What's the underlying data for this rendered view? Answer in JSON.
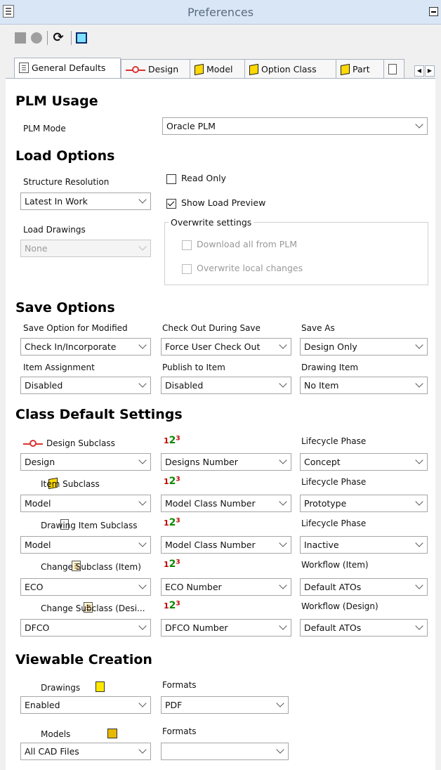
{
  "window": {
    "title": "Preferences"
  },
  "tabs": [
    "General Defaults",
    "Design",
    "Model",
    "Option Class",
    "Part"
  ],
  "plm": {
    "heading": "PLM Usage",
    "mode_label": "PLM Mode",
    "mode_value": "Oracle PLM"
  },
  "load": {
    "heading": "Load Options",
    "structure_label": "Structure Resolution",
    "structure_value": "Latest In Work",
    "drawings_label": "Load Drawings",
    "drawings_value": "None",
    "read_only_label": "Read Only",
    "read_only_checked": false,
    "show_preview_label": "Show Load Preview",
    "show_preview_checked": true,
    "overwrite_group": "Overwrite settings",
    "download_all_label": "Download all from PLM",
    "overwrite_local_label": "Overwrite local changes"
  },
  "save": {
    "heading": "Save Options",
    "modified_label": "Save Option for Modified",
    "modified_value": "Check In/Incorporate",
    "checkout_label": "Check Out During Save",
    "checkout_value": "Force User Check Out",
    "saveas_label": "Save As",
    "saveas_value": "Design Only",
    "item_assign_label": "Item Assignment",
    "item_assign_value": "Disabled",
    "publish_label": "Publish to Item",
    "publish_value": "Disabled",
    "drawing_item_label": "Drawing Item",
    "drawing_item_value": "No Item"
  },
  "class": {
    "heading": "Class Default Settings",
    "rows": [
      {
        "label": "Design Subclass",
        "icon": "design-icon",
        "sub": "Design",
        "num": "Designs Number",
        "rlabel": "Lifecycle Phase",
        "rval": "Concept"
      },
      {
        "label": "Item Subclass",
        "icon": "cube-icon",
        "sub": "Model",
        "num": "Model Class Number",
        "rlabel": "Lifecycle Phase",
        "rval": "Prototype"
      },
      {
        "label": "Drawing Item Subclass",
        "icon": "page-icon",
        "sub": "Model",
        "num": "Model Class Number",
        "rlabel": "Lifecycle Phase",
        "rval": "Inactive"
      },
      {
        "label": "Change Subclass (Item)",
        "icon": "change-icon",
        "sub": "ECO",
        "num": "ECO Number",
        "rlabel": "Workflow (Item)",
        "rval": "Default ATOs"
      },
      {
        "label": "Change Subclass (Desi...",
        "icon": "change-icon",
        "sub": "DFCO",
        "num": "DFCO Number",
        "rlabel": "Workflow (Design)",
        "rval": "Default ATOs"
      }
    ]
  },
  "viewable": {
    "heading": "Viewable Creation",
    "drawings_label": "Drawings",
    "drawings_value": "Enabled",
    "drawings_formats_label": "Formats",
    "drawings_formats_value": "PDF",
    "models_label": "Models",
    "models_value": "All CAD Files",
    "models_formats_label": "Formats",
    "models_formats_value": ""
  }
}
